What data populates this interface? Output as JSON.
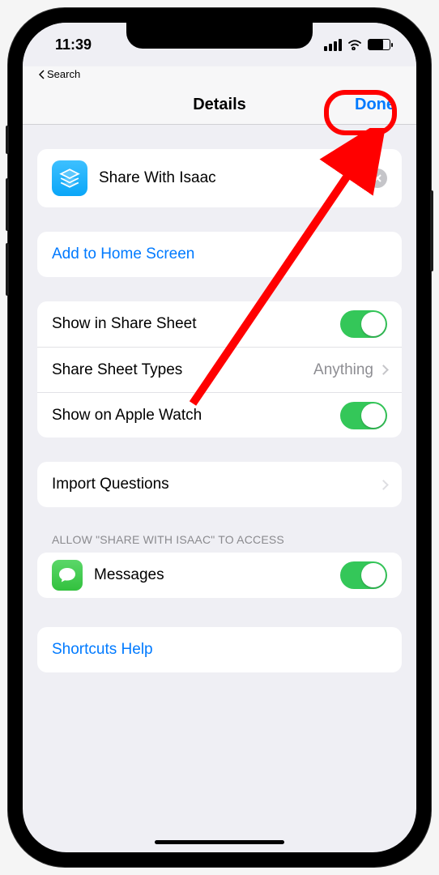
{
  "status": {
    "time": "11:39"
  },
  "back_label": "Search",
  "nav": {
    "title": "Details",
    "done": "Done"
  },
  "shortcut": {
    "name": "Share With Isaac"
  },
  "actions": {
    "add_home": "Add to Home Screen"
  },
  "share": {
    "show_sheet": "Show in Share Sheet",
    "types_label": "Share Sheet Types",
    "types_value": "Anything",
    "apple_watch": "Show on Apple Watch"
  },
  "import_label": "Import Questions",
  "access_header": "ALLOW \"SHARE WITH ISAAC\" TO ACCESS",
  "access": {
    "messages": "Messages"
  },
  "help_label": "Shortcuts Help"
}
